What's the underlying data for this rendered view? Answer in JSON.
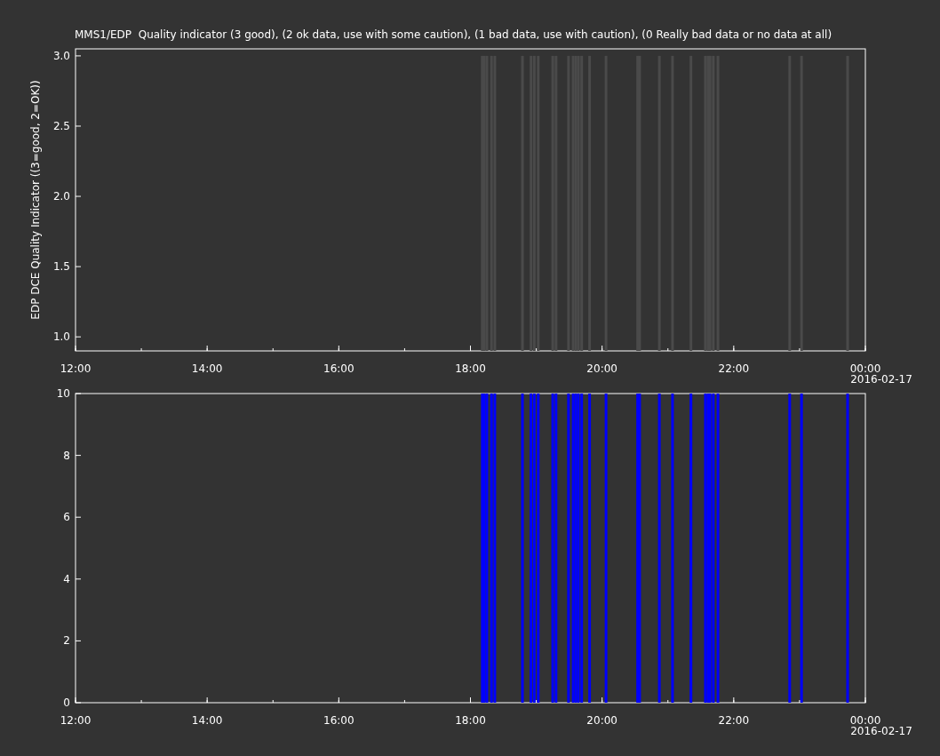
{
  "title": "MMS1/EDP  Quality indicator (3 good), (2 ok data, use with some caution), (1 bad data, use with caution), (0 Really bad data or no data at all)",
  "plots": [
    {
      "date_label": "2016-02-17",
      "chart_data": {
        "type": "bar",
        "ylabel": "EDP DCE Quality Indicator ((3=good, 2=OK))",
        "xlim": [
          12,
          24
        ],
        "ylim": [
          0.9,
          3.05
        ],
        "xticks": [
          {
            "value": 12,
            "label": "12:00"
          },
          {
            "value": 14,
            "label": "14:00"
          },
          {
            "value": 16,
            "label": "16:00"
          },
          {
            "value": 18,
            "label": "18:00"
          },
          {
            "value": 20,
            "label": "20:00"
          },
          {
            "value": 22,
            "label": "22:00"
          },
          {
            "value": 24,
            "label": "00:00"
          }
        ],
        "yticks": [
          {
            "value": 1,
            "label": "1.0"
          },
          {
            "value": 1.5,
            "label": "1.5"
          },
          {
            "value": 2,
            "label": "2.0"
          },
          {
            "value": 2.5,
            "label": "2.5"
          },
          {
            "value": 3,
            "label": "3.0"
          }
        ],
        "x": [
          18.18,
          18.21,
          18.25,
          18.32,
          18.37,
          18.79,
          18.92,
          18.97,
          19.03,
          19.25,
          19.3,
          19.49,
          19.56,
          19.6,
          19.64,
          19.69,
          19.81,
          20.06,
          20.54,
          20.57,
          20.87,
          21.07,
          21.35,
          21.57,
          21.61,
          21.64,
          21.69,
          21.76,
          22.85,
          23.03,
          23.73
        ],
        "series": [
          {
            "color": "#4a4a4a",
            "values": [
              3,
              3,
              3,
              3,
              3,
              3,
              3,
              3,
              3,
              3,
              3,
              3,
              3,
              3,
              3,
              3,
              3,
              3,
              3,
              3,
              3,
              3,
              3,
              3,
              3,
              3,
              3,
              3,
              3,
              3,
              3
            ]
          }
        ]
      }
    },
    {
      "date_label": "2016-02-17",
      "chart_data": {
        "type": "bar",
        "xlim": [
          12,
          24
        ],
        "ylim": [
          0,
          10
        ],
        "xticks": [
          {
            "value": 12,
            "label": "12:00"
          },
          {
            "value": 14,
            "label": "14:00"
          },
          {
            "value": 16,
            "label": "16:00"
          },
          {
            "value": 18,
            "label": "18:00"
          },
          {
            "value": 20,
            "label": "20:00"
          },
          {
            "value": 22,
            "label": "22:00"
          },
          {
            "value": 24,
            "label": "00:00"
          }
        ],
        "yticks": [
          {
            "value": 0,
            "label": "0"
          },
          {
            "value": 2,
            "label": "2"
          },
          {
            "value": 4,
            "label": "4"
          },
          {
            "value": 6,
            "label": "6"
          },
          {
            "value": 8,
            "label": "8"
          },
          {
            "value": 10,
            "label": "10"
          }
        ],
        "x": [
          18.18,
          18.21,
          18.25,
          18.32,
          18.37,
          18.79,
          18.92,
          18.97,
          19.03,
          19.25,
          19.3,
          19.49,
          19.56,
          19.6,
          19.64,
          19.69,
          19.81,
          20.06,
          20.54,
          20.57,
          20.87,
          21.07,
          21.35,
          21.57,
          21.61,
          21.64,
          21.69,
          21.76,
          22.85,
          23.03,
          23.73
        ],
        "series": [
          {
            "color": "#0000ff",
            "values": [
              10,
              10,
              10,
              10,
              10,
              10,
              10,
              10,
              10,
              10,
              10,
              10,
              10,
              10,
              10,
              10,
              10,
              10,
              10,
              10,
              10,
              10,
              10,
              10,
              10,
              10,
              10,
              10,
              10,
              10,
              10
            ]
          }
        ]
      }
    }
  ]
}
